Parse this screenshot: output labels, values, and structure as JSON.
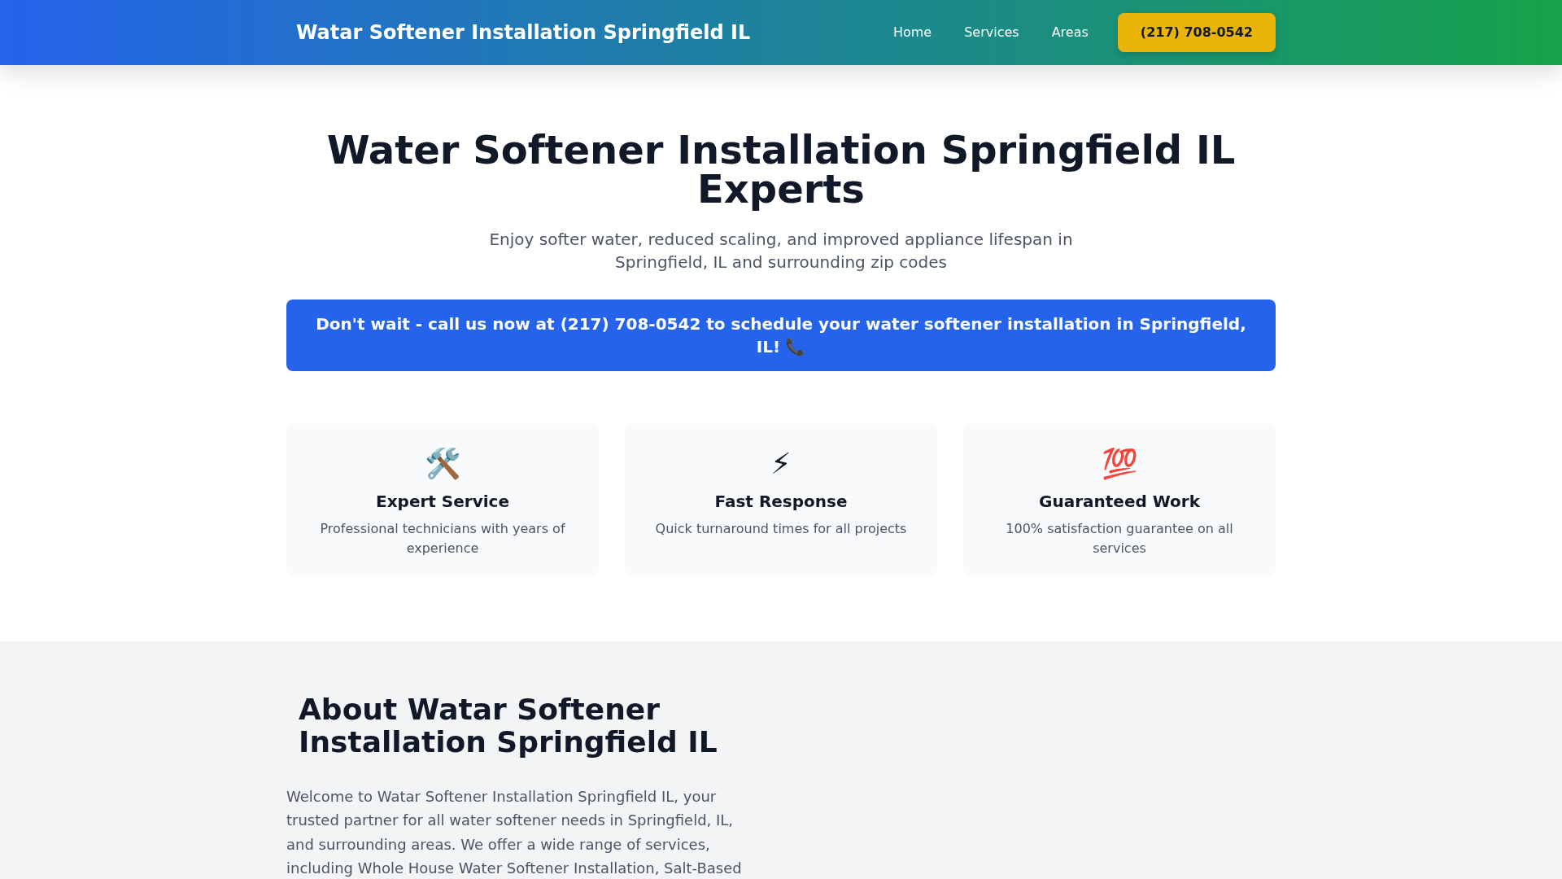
{
  "header": {
    "brand": "Watar Softener Installation Springfield IL",
    "nav": [
      "Home",
      "Services",
      "Areas"
    ],
    "phone_button": "(217) 708-0542"
  },
  "hero": {
    "title": "Water Softener Installation Springfield IL Experts",
    "subtitle": "Enjoy softer water, reduced scaling, and improved appliance lifespan in Springfield, IL and surrounding zip codes",
    "cta": {
      "text": "Don't wait - call us now at (217) 708-0542 to schedule your water softener installation in Springfield, IL!",
      "icon": "📞"
    }
  },
  "features": [
    {
      "icon": "🛠️",
      "title": "Expert Service",
      "text": "Professional technicians with years of experience"
    },
    {
      "icon": "⚡",
      "title": "Fast Response",
      "text": "Quick turnaround times for all projects"
    },
    {
      "icon": "💯",
      "title": "Guaranteed Work",
      "text": "100% satisfaction guarantee on all services"
    }
  ],
  "about": {
    "title": "About Watar Softener Installation Springfield IL",
    "text": "Welcome to Watar Softener Installation Springfield IL, your trusted partner for all water softener needs in Springfield, IL, and surrounding areas. We offer a wide range of services, including Whole House Water Softener Installation, Salt-Based"
  }
}
